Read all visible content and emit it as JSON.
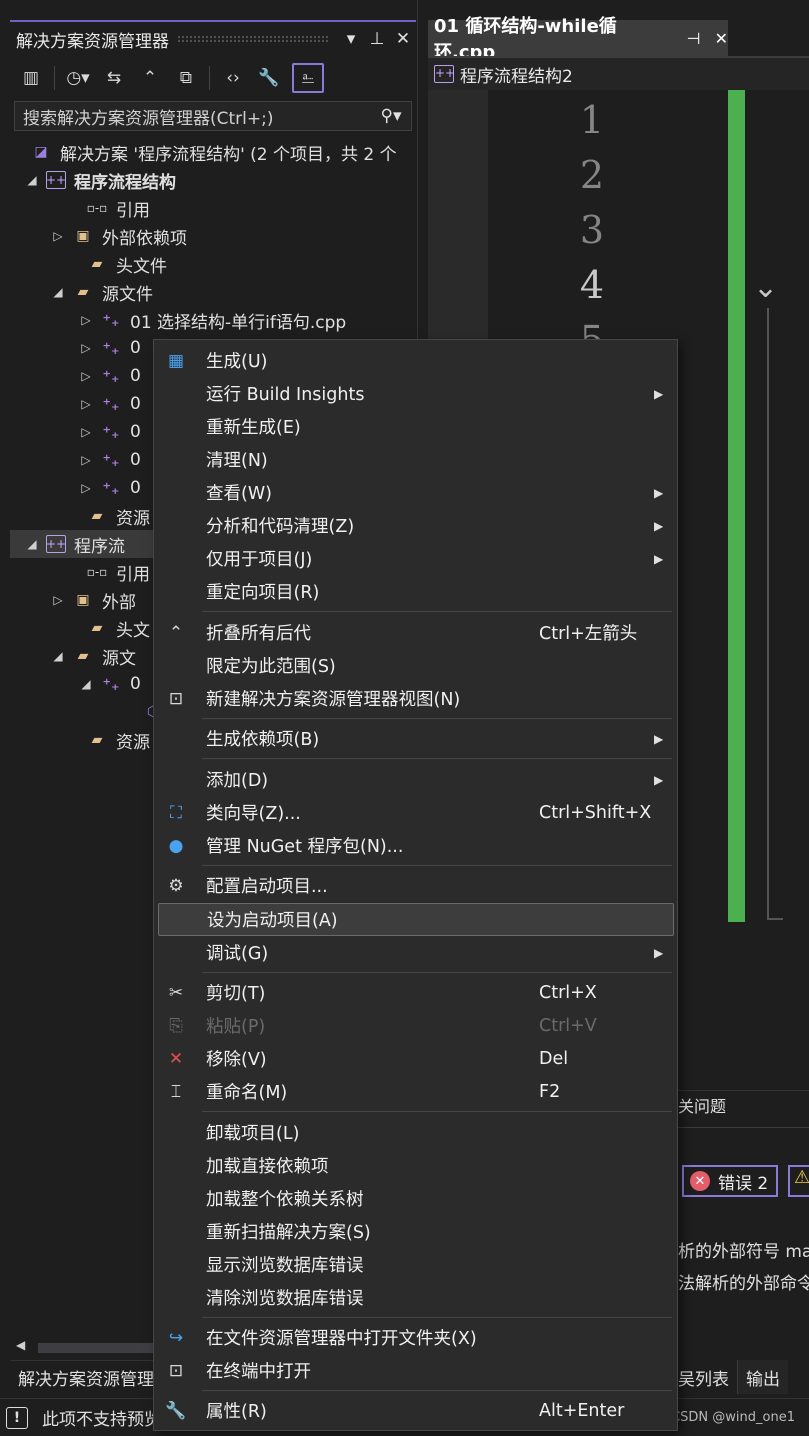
{
  "solution_explorer": {
    "title": "解决方案资源管理器",
    "search_placeholder": "搜索解决方案资源管理器(Ctrl+;)",
    "solution_label": "解决方案 '程序流程结构' (2 个项目，共 2 个",
    "tree": [
      {
        "label": "程序流程结构",
        "bold": true
      },
      {
        "label": "引用"
      },
      {
        "label": "外部依赖项"
      },
      {
        "label": "头文件"
      },
      {
        "label": "源文件"
      },
      {
        "label": "01 选择结构-单行if语句.cpp"
      },
      {
        "label": "0"
      },
      {
        "label": "0"
      },
      {
        "label": "0"
      },
      {
        "label": "0"
      },
      {
        "label": "0"
      },
      {
        "label": "0"
      },
      {
        "label": "资源"
      },
      {
        "label": "程序流"
      },
      {
        "label": "引用"
      },
      {
        "label": "外部"
      },
      {
        "label": "头文"
      },
      {
        "label": "源文"
      },
      {
        "label": "0"
      },
      {
        "label": "资源"
      }
    ],
    "bottom_tab": "解决方案资源管理"
  },
  "editor": {
    "tab_title": "01 循环结构-while循环.cpp",
    "nav_scope": "程序流程结构2",
    "line_numbers": [
      "1",
      "2",
      "3",
      "4",
      "5"
    ]
  },
  "error_list": {
    "header": "关问题",
    "error_badge": "错误 2",
    "line1": "析的外部符号 ma",
    "line2": "法解析的外部命令",
    "tab_error_list": "吴列表",
    "tab_output": "输出"
  },
  "status_bar": {
    "text": "此项不支持预览",
    "watermark": "CSDN @wind_one1"
  },
  "context_menu": {
    "items": [
      {
        "label": "生成(U)",
        "icon": "build-icon"
      },
      {
        "label": "运行 Build Insights",
        "submenu": true
      },
      {
        "label": "重新生成(E)"
      },
      {
        "label": "清理(N)"
      },
      {
        "label": "查看(W)",
        "submenu": true
      },
      {
        "label": "分析和代码清理(Z)",
        "submenu": true
      },
      {
        "label": "仅用于项目(J)",
        "submenu": true
      },
      {
        "label": "重定向项目(R)"
      },
      {
        "label": "折叠所有后代",
        "shortcut": "Ctrl+左箭头",
        "icon": "collapse-icon"
      },
      {
        "label": "限定为此范围(S)"
      },
      {
        "label": "新建解决方案资源管理器视图(N)",
        "icon": "new-view-icon"
      },
      {
        "label": "生成依赖项(B)",
        "submenu": true
      },
      {
        "label": "添加(D)",
        "submenu": true
      },
      {
        "label": "类向导(Z)...",
        "shortcut": "Ctrl+Shift+X",
        "icon": "class-wizard-icon"
      },
      {
        "label": "管理 NuGet 程序包(N)...",
        "icon": "nuget-icon"
      },
      {
        "label": "配置启动项目...",
        "icon": "gear-icon"
      },
      {
        "label": "设为启动项目(A)",
        "highlighted": true
      },
      {
        "label": "调试(G)",
        "submenu": true
      },
      {
        "label": "剪切(T)",
        "shortcut": "Ctrl+X",
        "icon": "scissors-icon"
      },
      {
        "label": "粘贴(P)",
        "shortcut": "Ctrl+V",
        "disabled": true,
        "icon": "paste-icon"
      },
      {
        "label": "移除(V)",
        "shortcut": "Del",
        "icon": "remove-icon"
      },
      {
        "label": "重命名(M)",
        "shortcut": "F2",
        "icon": "rename-icon"
      },
      {
        "label": "卸载项目(L)"
      },
      {
        "label": "加载直接依赖项"
      },
      {
        "label": "加载整个依赖关系树"
      },
      {
        "label": "重新扫描解决方案(S)"
      },
      {
        "label": "显示浏览数据库错误"
      },
      {
        "label": "清除浏览数据库错误"
      },
      {
        "label": "在文件资源管理器中打开文件夹(X)",
        "icon": "open-folder-icon"
      },
      {
        "label": "在终端中打开",
        "icon": "terminal-icon"
      },
      {
        "label": "属性(R)",
        "shortcut": "Alt+Enter",
        "icon": "wrench-icon"
      }
    ]
  },
  "colors": {
    "accent": "#8a7bd8",
    "change_bar": "#4caf50",
    "error_red": "#e35d6a"
  }
}
